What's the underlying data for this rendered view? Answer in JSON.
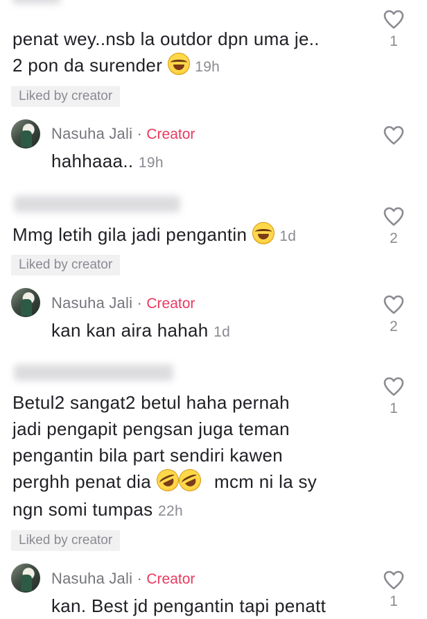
{
  "comments": [
    {
      "text_line1": "penat wey..nsb la outdor dpn uma je..",
      "text_line2": "2 pon da surender",
      "time": "19h",
      "liked": "Liked by creator",
      "likes": "1"
    },
    {
      "author": "Nasuha Jali",
      "separator": "·",
      "badge": "Creator",
      "text": "hahhaaa..",
      "time": "19h"
    },
    {
      "text": "Mmg letih gila jadi pengantin",
      "time": "1d",
      "liked": "Liked by creator",
      "likes": "2"
    },
    {
      "author": "Nasuha Jali",
      "separator": "·",
      "badge": "Creator",
      "text": "kan kan aira hahah",
      "time": "1d",
      "likes": "2"
    },
    {
      "line1": "Betul2 sangat2 betul haha pernah",
      "line2": "jadi pengapit pengsan juga teman",
      "line3": "pengantin bila part sendiri kawen",
      "line4a": "perghh penat dia",
      "line4b": "mcm ni la sy",
      "line5": "ngn somi tumpas",
      "time": "22h",
      "liked": "Liked by creator",
      "likes": "1"
    },
    {
      "author": "Nasuha Jali",
      "separator": "·",
      "badge": "Creator",
      "text": "kan. Best jd pengantin tapi penatt",
      "likes": "1"
    }
  ],
  "colors": {
    "creator": "#e8395f",
    "muted": "#8a8b91",
    "pill": "#f1f1f2"
  },
  "icons": {
    "like": "heart-outline-icon",
    "emoji": "laughing-emoji-icon"
  }
}
